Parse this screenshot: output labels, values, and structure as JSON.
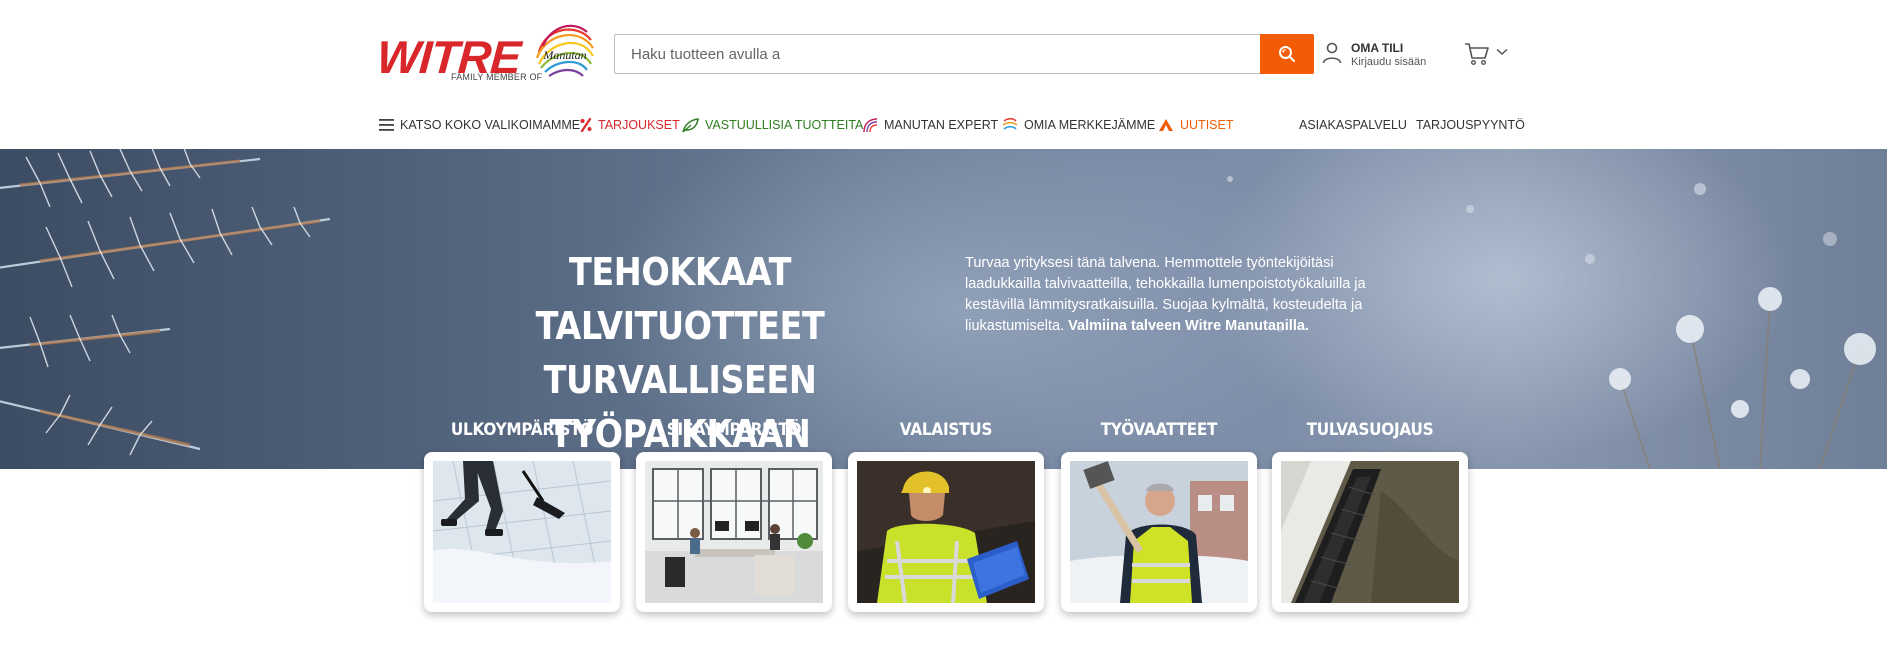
{
  "brand": {
    "name": "WITRE",
    "tagline": "FAMILY MEMBER OF",
    "badge": "Manutan",
    "primary_color": "#d8262a",
    "accent_color": "#f25c05"
  },
  "search": {
    "placeholder": "Haku tuotteen avulla a",
    "button_icon": "search-icon"
  },
  "account": {
    "title": "OMA TILI",
    "subtitle": "Kirjaudu sisään",
    "icon": "user-icon"
  },
  "cart": {
    "icon": "cart-icon",
    "dropdown_icon": "chevron-down-icon"
  },
  "nav": {
    "all_products": "KATSO KOKO VALIKOIMAMME",
    "offers": "TARJOUKSET",
    "sustainable": "VASTUULLISIA TUOTTEITA",
    "expert": "MANUTAN EXPERT",
    "own_brands": "OMIA MERKKEJÄMME",
    "news": "UUTISET",
    "customer_service": "ASIAKASPALVELU",
    "quote_request": "TARJOUSPYYNTÖ",
    "colors": {
      "offers": "#d8262a",
      "sustainable": "#2e7d1e",
      "news": "#f25c05"
    }
  },
  "hero": {
    "title_line1": "TEHOKKAAT TALVITUOTTEET",
    "title_line2": "TURVALLISEEN TYÖPAIKKAAN",
    "text": "Turvaa yrityksesi tänä talvena. Hemmottele työntekijöitäsi laadukkailla talvivaatteilla, tehokkailla lumenpoistotyökaluilla ja kestävillä lämmitysratkaisuilla. Suojaa kylmältä, kosteudelta ja liukastumiselta.",
    "text_bold": "Valmiina talveen Witre Manutanilla."
  },
  "categories": [
    {
      "label": "ULKOYMPÄRISTÖ"
    },
    {
      "label": "SISÄYMPÄRISTÖ"
    },
    {
      "label": "VALAISTUS"
    },
    {
      "label": "TYÖVAATTEET"
    },
    {
      "label": "TULVASUOJAUS"
    }
  ]
}
